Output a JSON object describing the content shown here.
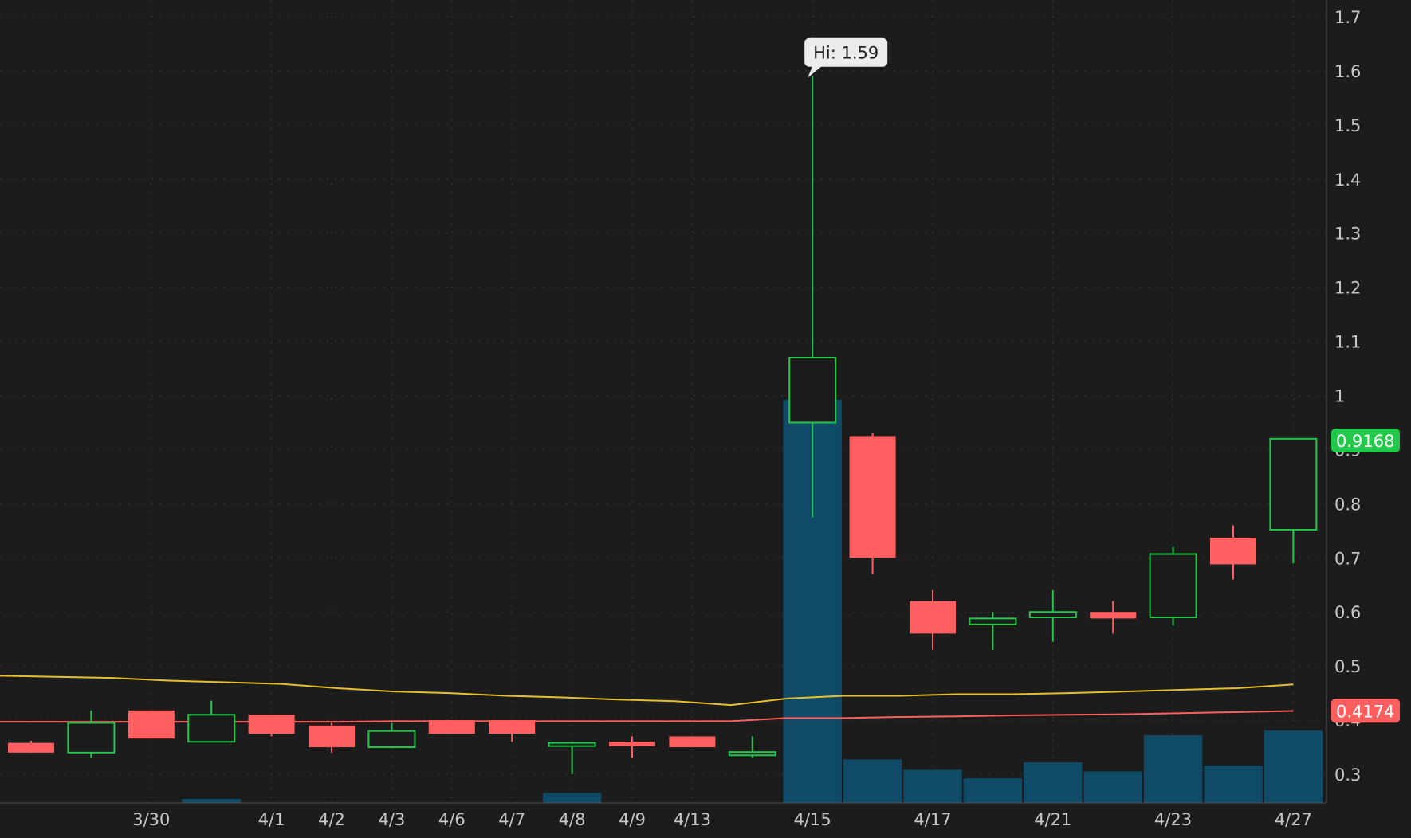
{
  "colors": {
    "background": "#1c1c1c",
    "up": "#22c84a",
    "down": "#ff5f5f",
    "volume": "#0f4a66",
    "ma_yellow": "#e6c02a",
    "ma_red": "#ff5f5f",
    "axis_text": "#c8c8c8"
  },
  "chart_data": {
    "type": "candlestick",
    "title": "",
    "grid": true,
    "y_axis": {
      "side": "right",
      "range": [
        0.25,
        1.72
      ],
      "ticks": [
        {
          "value": 0.3,
          "label": "0.3"
        },
        {
          "value": 0.4,
          "label": "0.4"
        },
        {
          "value": 0.5,
          "label": "0.5"
        },
        {
          "value": 0.6,
          "label": "0.6"
        },
        {
          "value": 0.7,
          "label": "0.7"
        },
        {
          "value": 0.8,
          "label": "0.8"
        },
        {
          "value": 0.9,
          "label": "0.9"
        },
        {
          "value": 1.0,
          "label": "1"
        },
        {
          "value": 1.1,
          "label": "1.1"
        },
        {
          "value": 1.2,
          "label": "1.2"
        },
        {
          "value": 1.3,
          "label": "1.3"
        },
        {
          "value": 1.4,
          "label": "1.4"
        },
        {
          "value": 1.5,
          "label": "1.5"
        },
        {
          "value": 1.6,
          "label": "1.6"
        },
        {
          "value": 1.7,
          "label": "1.7"
        }
      ]
    },
    "x_labels": [
      {
        "index": 2,
        "label": "3/30"
      },
      {
        "index": 4,
        "label": "4/1"
      },
      {
        "index": 5,
        "label": "4/2"
      },
      {
        "index": 6,
        "label": "4/3"
      },
      {
        "index": 7,
        "label": "4/6"
      },
      {
        "index": 8,
        "label": "4/7"
      },
      {
        "index": 9,
        "label": "4/8"
      },
      {
        "index": 10,
        "label": "4/9"
      },
      {
        "index": 11,
        "label": "4/13"
      },
      {
        "index": 13,
        "label": "4/15"
      },
      {
        "index": 15,
        "label": "4/17"
      },
      {
        "index": 17,
        "label": "4/21"
      },
      {
        "index": 19,
        "label": "4/23"
      },
      {
        "index": 21,
        "label": "4/27"
      }
    ],
    "candles": [
      {
        "o": 0.358,
        "h": 0.362,
        "l": 0.34,
        "c": 0.34
      },
      {
        "o": 0.34,
        "h": 0.418,
        "l": 0.33,
        "c": 0.395
      },
      {
        "o": 0.418,
        "h": 0.418,
        "l": 0.366,
        "c": 0.366
      },
      {
        "o": 0.36,
        "h": 0.436,
        "l": 0.36,
        "c": 0.41
      },
      {
        "o": 0.41,
        "h": 0.41,
        "l": 0.37,
        "c": 0.375
      },
      {
        "o": 0.39,
        "h": 0.395,
        "l": 0.34,
        "c": 0.35
      },
      {
        "o": 0.35,
        "h": 0.395,
        "l": 0.35,
        "c": 0.38
      },
      {
        "o": 0.4,
        "h": 0.4,
        "l": 0.375,
        "c": 0.375
      },
      {
        "o": 0.4,
        "h": 0.4,
        "l": 0.36,
        "c": 0.375
      },
      {
        "o": 0.352,
        "h": 0.36,
        "l": 0.3,
        "c": 0.358
      },
      {
        "o": 0.36,
        "h": 0.37,
        "l": 0.33,
        "c": 0.352
      },
      {
        "o": 0.37,
        "h": 0.37,
        "l": 0.35,
        "c": 0.35
      },
      {
        "o": 0.335,
        "h": 0.37,
        "l": 0.33,
        "c": 0.341
      },
      {
        "o": 0.95,
        "h": 1.59,
        "l": 0.775,
        "c": 1.07
      },
      {
        "o": 0.925,
        "h": 0.93,
        "l": 0.67,
        "c": 0.7
      },
      {
        "o": 0.62,
        "h": 0.64,
        "l": 0.53,
        "c": 0.56
      },
      {
        "o": 0.577,
        "h": 0.6,
        "l": 0.53,
        "c": 0.588
      },
      {
        "o": 0.59,
        "h": 0.64,
        "l": 0.545,
        "c": 0.6
      },
      {
        "o": 0.6,
        "h": 0.62,
        "l": 0.56,
        "c": 0.588
      },
      {
        "o": 0.59,
        "h": 0.72,
        "l": 0.575,
        "c": 0.707
      },
      {
        "o": 0.737,
        "h": 0.76,
        "l": 0.66,
        "c": 0.688
      },
      {
        "o": 0.752,
        "h": 0.92,
        "l": 0.69,
        "c": 0.92
      }
    ],
    "volume_relative": [
      0,
      0,
      0,
      0.01,
      0,
      0,
      0,
      0,
      0,
      0.025,
      0,
      0,
      0,
      1.0,
      0.108,
      0.082,
      0.061,
      0.101,
      0.078,
      0.168,
      0.093,
      0.18
    ],
    "ma_yellow": [
      0.482,
      0.48,
      0.478,
      0.473,
      0.47,
      0.467,
      0.459,
      0.453,
      0.45,
      0.445,
      0.442,
      0.438,
      0.435,
      0.428,
      0.44,
      0.445,
      0.445,
      0.448,
      0.448,
      0.45,
      0.453,
      0.456,
      0.459,
      0.466
    ],
    "ma_red": [
      0.397,
      0.397,
      0.397,
      0.397,
      0.397,
      0.397,
      0.397,
      0.398,
      0.398,
      0.398,
      0.398,
      0.398,
      0.398,
      0.398,
      0.404,
      0.404,
      0.406,
      0.407,
      0.409,
      0.41,
      0.411,
      0.413,
      0.415,
      0.417
    ],
    "price_badges": [
      {
        "value": 0.9168,
        "label": "0.9168",
        "color": "up"
      },
      {
        "value": 0.4174,
        "label": "0.4174",
        "color": "down"
      }
    ],
    "callout": {
      "index": 13,
      "value": 1.59,
      "label": "Hi: 1.59"
    }
  }
}
